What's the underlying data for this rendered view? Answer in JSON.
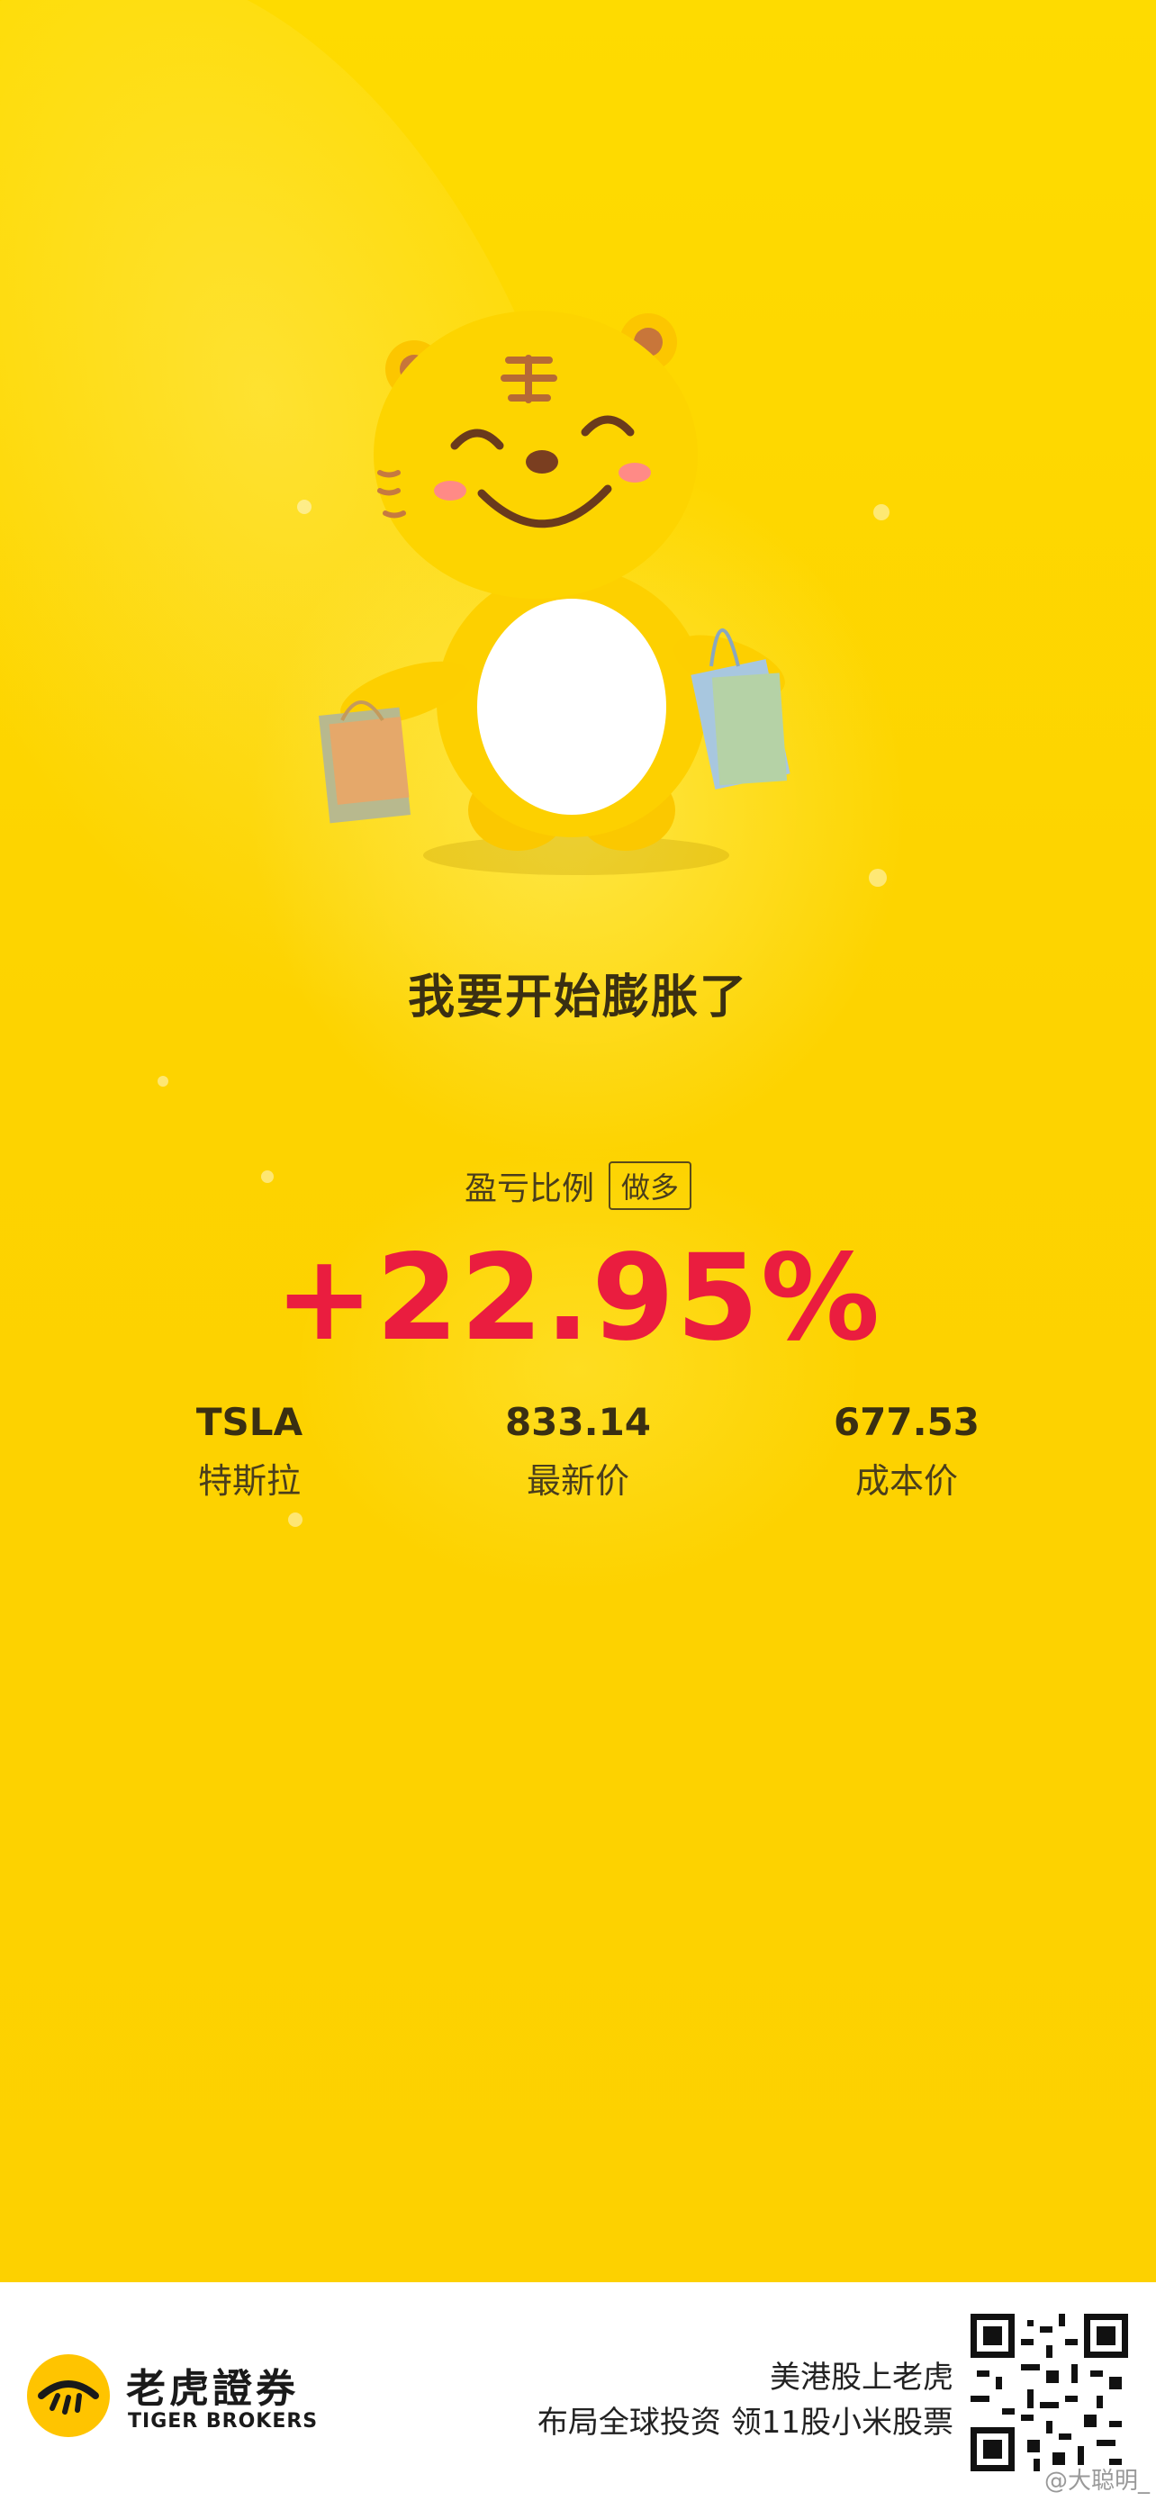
{
  "slogan": "我要开始膨胀了",
  "profit": {
    "label": "盈亏比例",
    "tag": "做多",
    "value": "+22.95%"
  },
  "stats": {
    "symbol": "TSLA",
    "name": "特斯拉",
    "last_price": "833.14",
    "last_price_label": "最新价",
    "cost_price": "677.53",
    "cost_price_label": "成本价"
  },
  "footer": {
    "brand_cn": "老虎證券",
    "brand_en": "TIGER BROKERS",
    "promo_line1": "美港股上老虎",
    "promo_line2": "布局全球投资 领11股小米股票"
  },
  "watermark": "@大聪明_",
  "colors": {
    "background": "#fdd300",
    "accent_red": "#ea1d3f",
    "brand_yellow": "#ffc400"
  }
}
